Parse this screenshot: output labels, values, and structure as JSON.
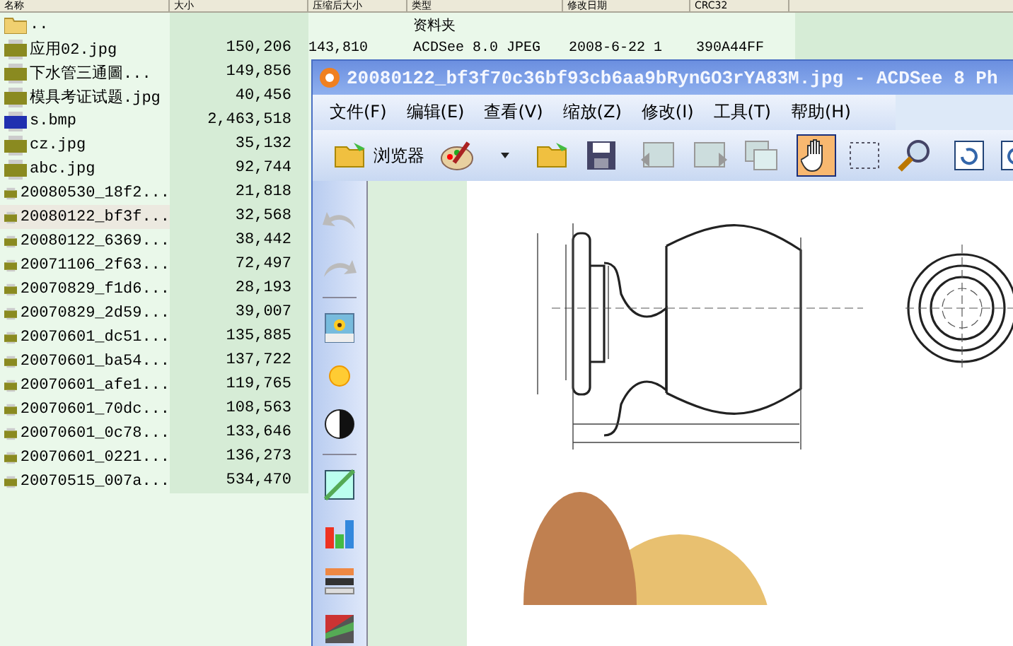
{
  "file_list": {
    "columns": [
      "名称",
      "大小",
      "压缩后大小",
      "类型",
      "修改日期",
      "CRC32"
    ],
    "rows": [
      {
        "kind": "folder",
        "name": "..",
        "size": "",
        "type": "资料夹",
        "selected": false
      },
      {
        "kind": "jpg",
        "name": "应用02.jpg",
        "size": "150,206",
        "packed": "143,810",
        "type": "ACDSee 8.0 JPEG",
        "date": "2008-6-22 1",
        "crc": "390A44FF",
        "selected": false
      },
      {
        "kind": "jpg",
        "name": "下水管三通圖...",
        "size": "149,856",
        "selected": false
      },
      {
        "kind": "jpg",
        "name": "模具考证试题.jpg",
        "size": "40,456",
        "selected": false
      },
      {
        "kind": "bmp",
        "name": "s.bmp",
        "size": "2,463,518",
        "selected": false
      },
      {
        "kind": "jpg",
        "name": "cz.jpg",
        "size": "35,132",
        "selected": false
      },
      {
        "kind": "jpg",
        "name": "abc.jpg",
        "size": "92,744",
        "selected": false
      },
      {
        "kind": "jpg",
        "name": "20080530_18f2...",
        "size": "21,818",
        "selected": false
      },
      {
        "kind": "jpg",
        "name": "20080122_bf3f...",
        "size": "32,568",
        "selected": true
      },
      {
        "kind": "jpg",
        "name": "20080122_6369...",
        "size": "38,442",
        "selected": false
      },
      {
        "kind": "jpg",
        "name": "20071106_2f63...",
        "size": "72,497",
        "selected": false
      },
      {
        "kind": "jpg",
        "name": "20070829_f1d6...",
        "size": "28,193",
        "selected": false
      },
      {
        "kind": "jpg",
        "name": "20070829_2d59...",
        "size": "39,007",
        "selected": false
      },
      {
        "kind": "jpg",
        "name": "20070601_dc51...",
        "size": "135,885",
        "selected": false
      },
      {
        "kind": "jpg",
        "name": "20070601_ba54...",
        "size": "137,722",
        "selected": false
      },
      {
        "kind": "jpg",
        "name": "20070601_afe1...",
        "size": "119,765",
        "selected": false
      },
      {
        "kind": "jpg",
        "name": "20070601_70dc...",
        "size": "108,563",
        "selected": false
      },
      {
        "kind": "jpg",
        "name": "20070601_0c78...",
        "size": "133,646",
        "selected": false
      },
      {
        "kind": "jpg",
        "name": "20070601_0221...",
        "size": "136,273",
        "selected": false
      },
      {
        "kind": "jpg",
        "name": "20070515_007a...",
        "size": "534,470",
        "selected": false
      }
    ]
  },
  "viewer": {
    "title": "20080122_bf3f70c36bf93cb6aa9bRynGO3rYA83M.jpg - ACDSee 8 Ph",
    "menu": [
      "文件(F)",
      "编辑(E)",
      "查看(V)",
      "缩放(Z)",
      "修改(I)",
      "工具(T)",
      "帮助(H)"
    ],
    "browser_button": "浏览器",
    "tools": [
      {
        "kind": "hand",
        "active": true
      },
      {
        "kind": "select",
        "active": false
      },
      {
        "kind": "zoom",
        "active": false
      }
    ]
  }
}
